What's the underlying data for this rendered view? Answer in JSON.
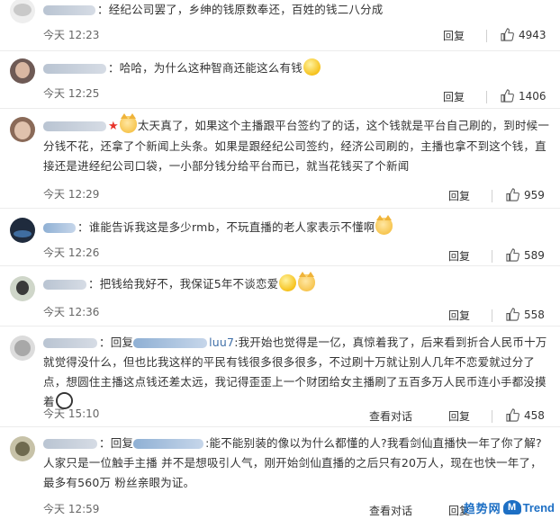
{
  "comments": [
    {
      "text": "：经纪公司罢了，乡绅的钱原数奉还，百姓的钱二八分成",
      "time": "今天 12:23",
      "reply_label": "回复",
      "likes": "4943"
    },
    {
      "text": "：哈哈，为什么这种智商还能这么有钱",
      "time": "今天 12:25",
      "reply_label": "回复",
      "likes": "1406"
    },
    {
      "text": "太天真了，如果这个主播跟平台签约了的话，这个钱就是平台自己刷的，到时候一分钱不花，还拿了个新闻上头条。如果是跟经纪公司签约，经济公司刷的，主播也拿不到这个钱，直接还是进经纪公司口袋，一小部分钱分给平台而已，就当花钱买了个新闻",
      "time": "今天 12:29",
      "reply_label": "回复",
      "likes": "959"
    },
    {
      "text": "：谁能告诉我这是多少rmb，不玩直播的老人家表示不懂啊",
      "time": "今天 12:26",
      "reply_label": "回复",
      "likes": "589"
    },
    {
      "text": "：把钱给我好不，我保证5年不谈恋爱",
      "time": "今天 12:36",
      "reply_label": "回复",
      "likes": "558"
    },
    {
      "prefix": "：回复",
      "mention_tail": "luu7",
      "text": ":我开始也觉得是一亿，真惊着我了，后来看到折合人民币十万就觉得没什么，但也比我这样的平民有钱很多很多很多，不过刷十万就让别人几年不恋爱就过分了点，想圆住主播这点钱还差太远，我记得歪歪上一个财团给女主播刷了五百多万人民币连小手都没摸着",
      "time": "今天 15:10",
      "view_replies_label": "查看对话",
      "reply_label": "回复",
      "likes": "458"
    },
    {
      "prefix": "：回复",
      "mention_tail": "",
      "text": ":能不能别装的像以为什么都懂的人?我看剑仙直播快一年了你了解?人家只是一位触手主播 并不是想吸引人气，刚开始剑仙直播的之后只有20万人，现在也快一年了，最多有560万 粉丝亲眼为证。",
      "time": "今天 12:59",
      "view_replies_label": "查看对话",
      "reply_label": "回复"
    }
  ],
  "watermark": {
    "cn": "趋势网",
    "logo_letter": "M",
    "en": "Trend"
  },
  "icons": {
    "like": "thumbs-up-icon",
    "emoji_laugh": "laughing-face-emoji",
    "emoji_cat": "cat-face-emoji",
    "emoji_panda": "panda-face-emoji",
    "star": "red-star-icon"
  }
}
